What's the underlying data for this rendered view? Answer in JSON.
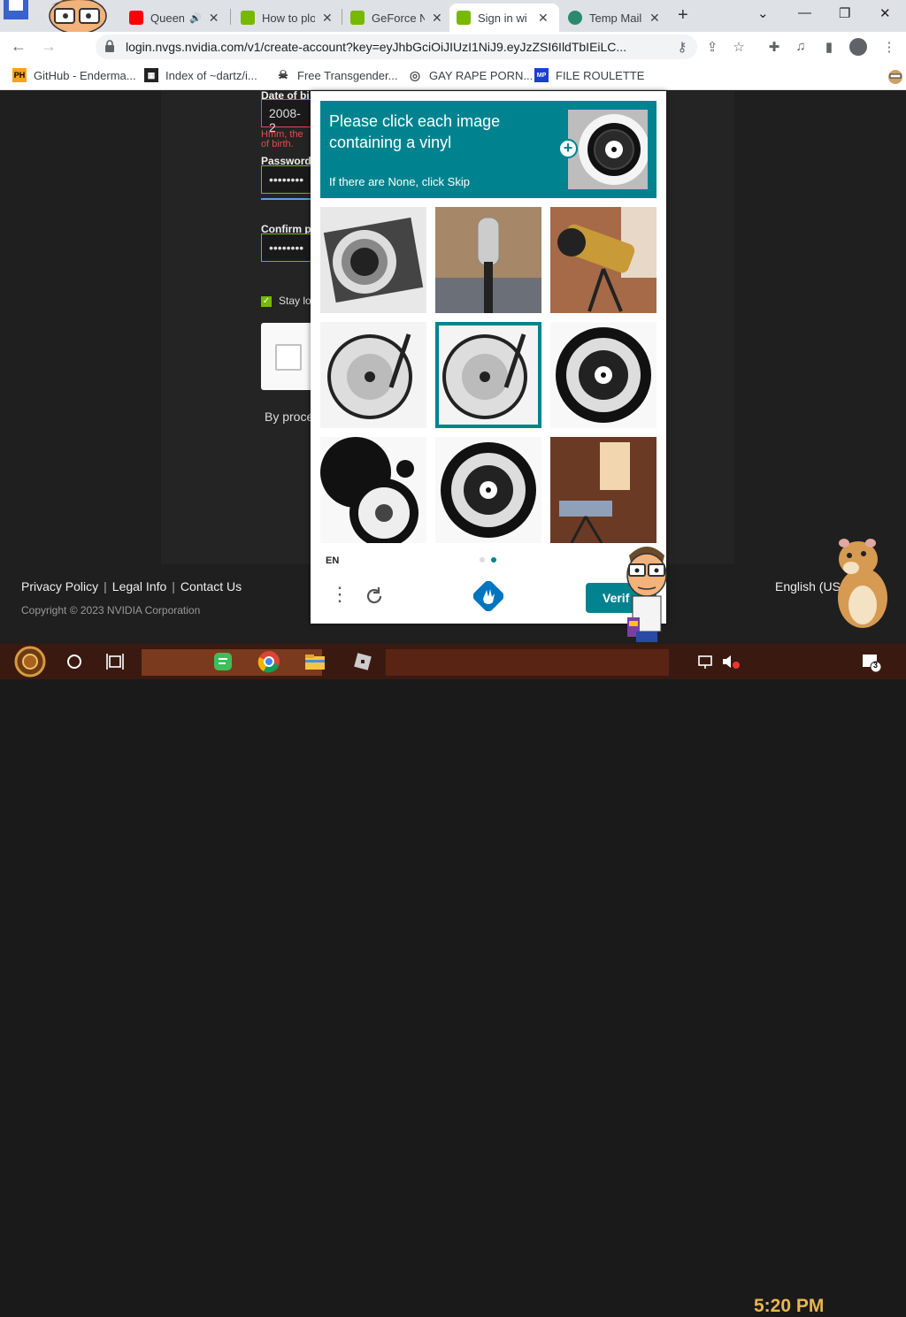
{
  "browser": {
    "tabs": [
      {
        "title": "Queen",
        "favicon": "youtube-icon",
        "color": "#ff0000",
        "close": "✕",
        "extra": "🔊"
      },
      {
        "title": "How to plo",
        "favicon": "nvidia-icon",
        "color": "#76b900",
        "close": "✕"
      },
      {
        "title": "GeForce N",
        "favicon": "nvidia-icon",
        "color": "#76b900",
        "close": "✕"
      },
      {
        "title": "Sign in wi",
        "favicon": "nvidia-icon",
        "color": "#76b900",
        "close": "✕"
      },
      {
        "title": "Temp Mail",
        "favicon": "tempmail-icon",
        "color": "#2b8a6e",
        "close": "✕"
      }
    ],
    "new_tab": "+",
    "window_controls": [
      "⌄",
      "—",
      "❐",
      "✕"
    ],
    "url": "login.nvgs.nvidia.com/v1/create-account?key=eyJhbGciOiJIUzI1NiJ9.eyJzZSI6IldTbIEiLC...",
    "bookmarks": [
      {
        "label": "GitHub - Enderma...",
        "icon": "ph-icon",
        "badge": "PH"
      },
      {
        "label": "Index of ~dartz/i...",
        "icon": "index-icon",
        "badge": "▦"
      },
      {
        "label": "Free Transgender...",
        "icon": "skull-icon",
        "badge": "☠"
      },
      {
        "label": "GAY RAPE PORN...",
        "icon": "globe-icon",
        "badge": "◎"
      },
      {
        "label": "FILE ROULETTE",
        "icon": "file-roulette-icon",
        "badge": "MP"
      }
    ]
  },
  "form": {
    "dob_label": "Date of bi",
    "dob_value": "2008-2",
    "dob_error": "Hmm, the",
    "dob_error_2": "of birth.",
    "password_label": "Password",
    "password_value": "••••••••",
    "confirm_label": "Confirm p",
    "confirm_value": "••••••••",
    "stay_label": "Stay lo",
    "proceed_text": "By proce"
  },
  "footer": {
    "links": [
      "Privacy Policy",
      "Legal Info",
      "Contact Us"
    ],
    "separator": "|",
    "copyright": "Copyright © 2023 NVIDIA Corporation",
    "language": "English (US"
  },
  "captcha": {
    "prompt": "Please click each image containing a vinyl",
    "skip_hint": "If there are None, click Skip",
    "language": "EN",
    "verify_label": "Verif",
    "accent": "#00838f",
    "tiles": [
      {
        "subject": "camera lens",
        "selected": false
      },
      {
        "subject": "microphone",
        "selected": false
      },
      {
        "subject": "telescope",
        "selected": false
      },
      {
        "subject": "turntable",
        "selected": false
      },
      {
        "subject": "turntable",
        "selected": true
      },
      {
        "subject": "vinyl record",
        "selected": false
      },
      {
        "subject": "record player",
        "selected": false
      },
      {
        "subject": "vinyl record",
        "selected": false
      },
      {
        "subject": "telescope in room",
        "selected": false
      }
    ]
  },
  "taskbar": {
    "clock": "5:20 PM",
    "notification_count": "3"
  }
}
